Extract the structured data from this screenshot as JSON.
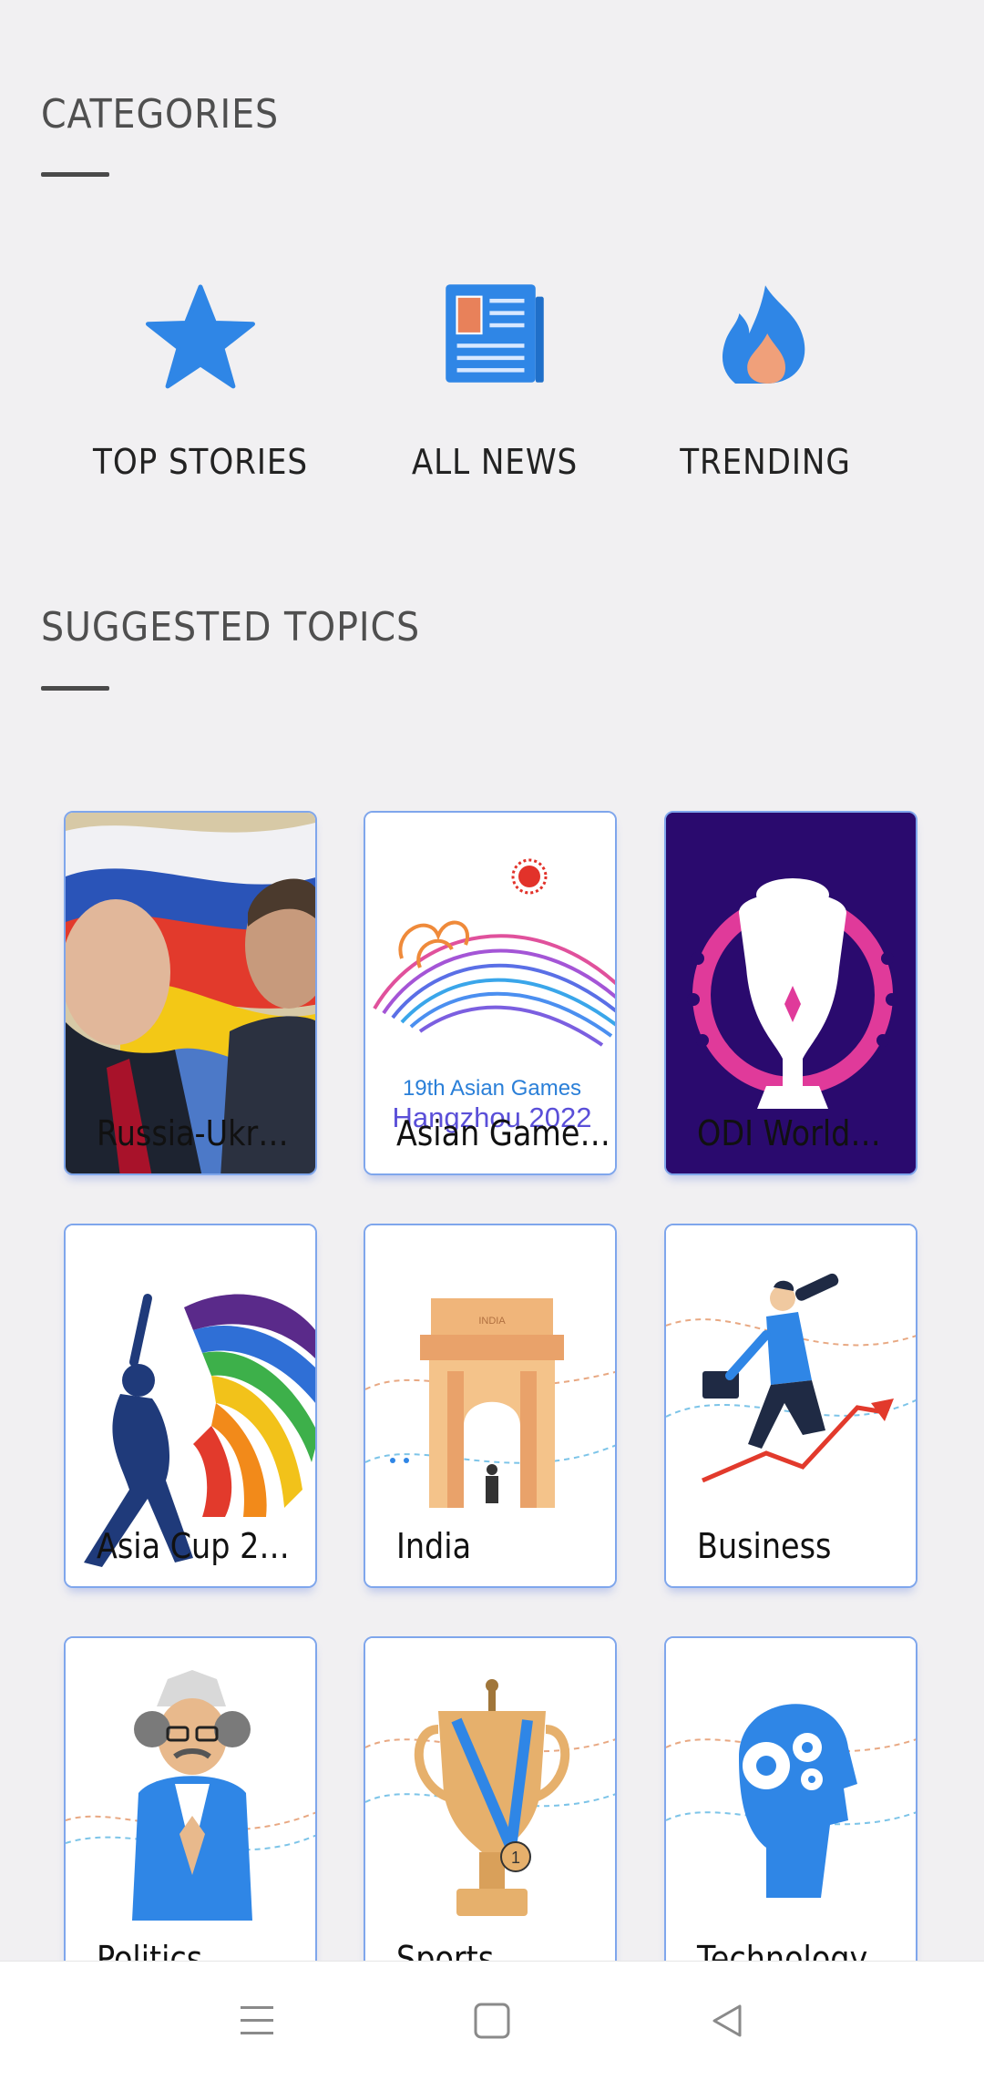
{
  "categories_section": {
    "title": "CATEGORIES"
  },
  "categories": [
    {
      "label": "TOP STORIES",
      "icon": "star-icon",
      "color": "#2f86e6"
    },
    {
      "label": "ALL NEWS",
      "icon": "newspaper-icon",
      "color": "#2f86e6"
    },
    {
      "label": "TRENDING",
      "icon": "flame-icon",
      "color": "#2f86e6"
    }
  ],
  "topics_section": {
    "title": "SUGGESTED TOPICS"
  },
  "topics": [
    {
      "label": "Russia-Ukr…"
    },
    {
      "label": "Asian Game…",
      "image_text_1": "19th Asian Games",
      "image_text_2": "Hangzhou 2022"
    },
    {
      "label": "ODI World…"
    },
    {
      "label": "Asia Cup 2…"
    },
    {
      "label": "India",
      "image_text_1": "INDIA"
    },
    {
      "label": "Business"
    },
    {
      "label": "Politics"
    },
    {
      "label": "Sports",
      "image_text_1": "1"
    },
    {
      "label": "Technology"
    }
  ],
  "colors": {
    "accent": "#2f86e6",
    "card_border": "#7fa6ec",
    "background": "#f1f0f2"
  },
  "navbar": {
    "menu_icon": "menu-icon",
    "home_icon": "home-square-icon",
    "back_icon": "back-triangle-icon"
  }
}
